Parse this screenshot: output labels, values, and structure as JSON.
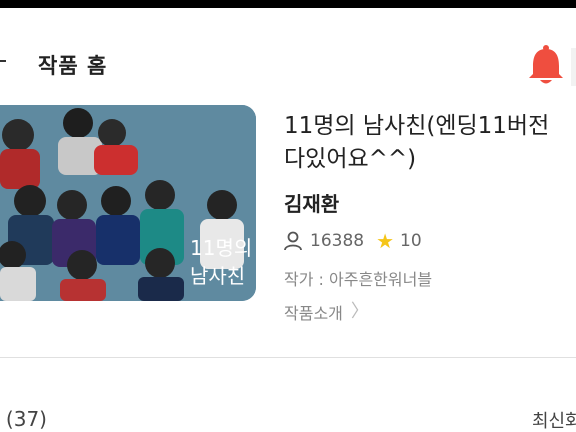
{
  "header": {
    "title": "작품 홈"
  },
  "cover": {
    "overlay_text_line1": "11명의",
    "overlay_text_line2": "남사친"
  },
  "work": {
    "title": "11명의 남사친(엔딩11버전 다있어요^^)",
    "author": "김재환",
    "views": "16388",
    "rating": "10",
    "writer": "작가 : 아주흔한워너블",
    "intro_link": "작품소개"
  },
  "episodes": {
    "count_label": "l (37)",
    "sort_label": "최신화"
  },
  "colors": {
    "bell": "#ef4e3f",
    "star": "#f5c518",
    "cover_bg": "#5f8aa0"
  }
}
